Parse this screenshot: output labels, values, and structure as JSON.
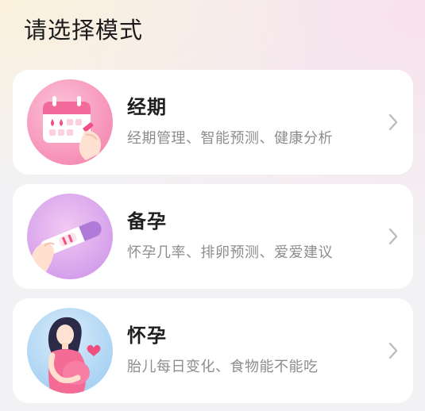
{
  "page": {
    "title": "请选择模式"
  },
  "modes": [
    {
      "title": "经期",
      "subtitle": "经期管理、智能预测、健康分析",
      "icon": "calendar-hand-icon",
      "accent": "#f57aa8"
    },
    {
      "title": "备孕",
      "subtitle": "怀孕几率、排卵预测、爱爱建议",
      "icon": "ovulation-test-strip-icon",
      "accent": "#c98be6"
    },
    {
      "title": "怀孕",
      "subtitle": "胎儿每日变化、食物能不能吃",
      "icon": "pregnant-woman-icon",
      "accent": "#8fc6f0"
    }
  ]
}
